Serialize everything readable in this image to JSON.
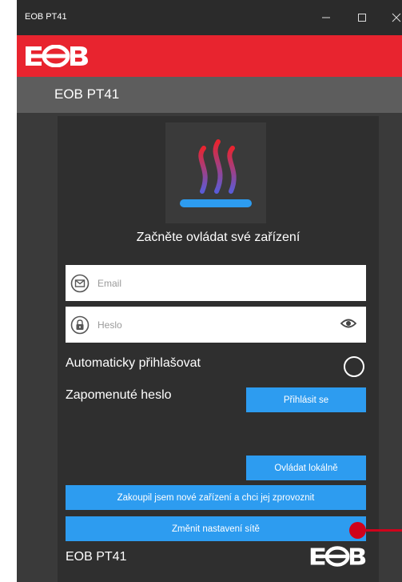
{
  "window": {
    "title": "EOB PT41",
    "controls": {
      "minimize": "—",
      "maximize": "☐",
      "close": "✕"
    }
  },
  "header": {
    "logo_icon": "eob-logo-icon",
    "app_title": "EOB PT41"
  },
  "login": {
    "app_icon": "heating-waves-icon",
    "tagline": "Začněte ovládat své zařízení",
    "email": {
      "placeholder": "Email",
      "value": ""
    },
    "password": {
      "placeholder": "Heslo",
      "value": ""
    },
    "auto_login_label": "Automaticky přihlašovat",
    "auto_login_checked": false,
    "forgot_password": "Zapomenuté heslo",
    "login_button": "Přihlásit se",
    "local_control_button": "Ovládat lokálně",
    "new_device_button": "Zakoupil jsem nové zařízení a chci jej zprovoznit",
    "network_settings_button": "Změnit nastavení sítě"
  },
  "footer": {
    "title": "EOB PT41",
    "logo_icon": "eob-logo-icon"
  },
  "colors": {
    "accent_red": "#e8242f",
    "button_blue": "#2d9cf0",
    "panel_dark": "#2f2f2f",
    "header_grey": "#5d5d5d",
    "annotation_red": "#d0021b"
  }
}
